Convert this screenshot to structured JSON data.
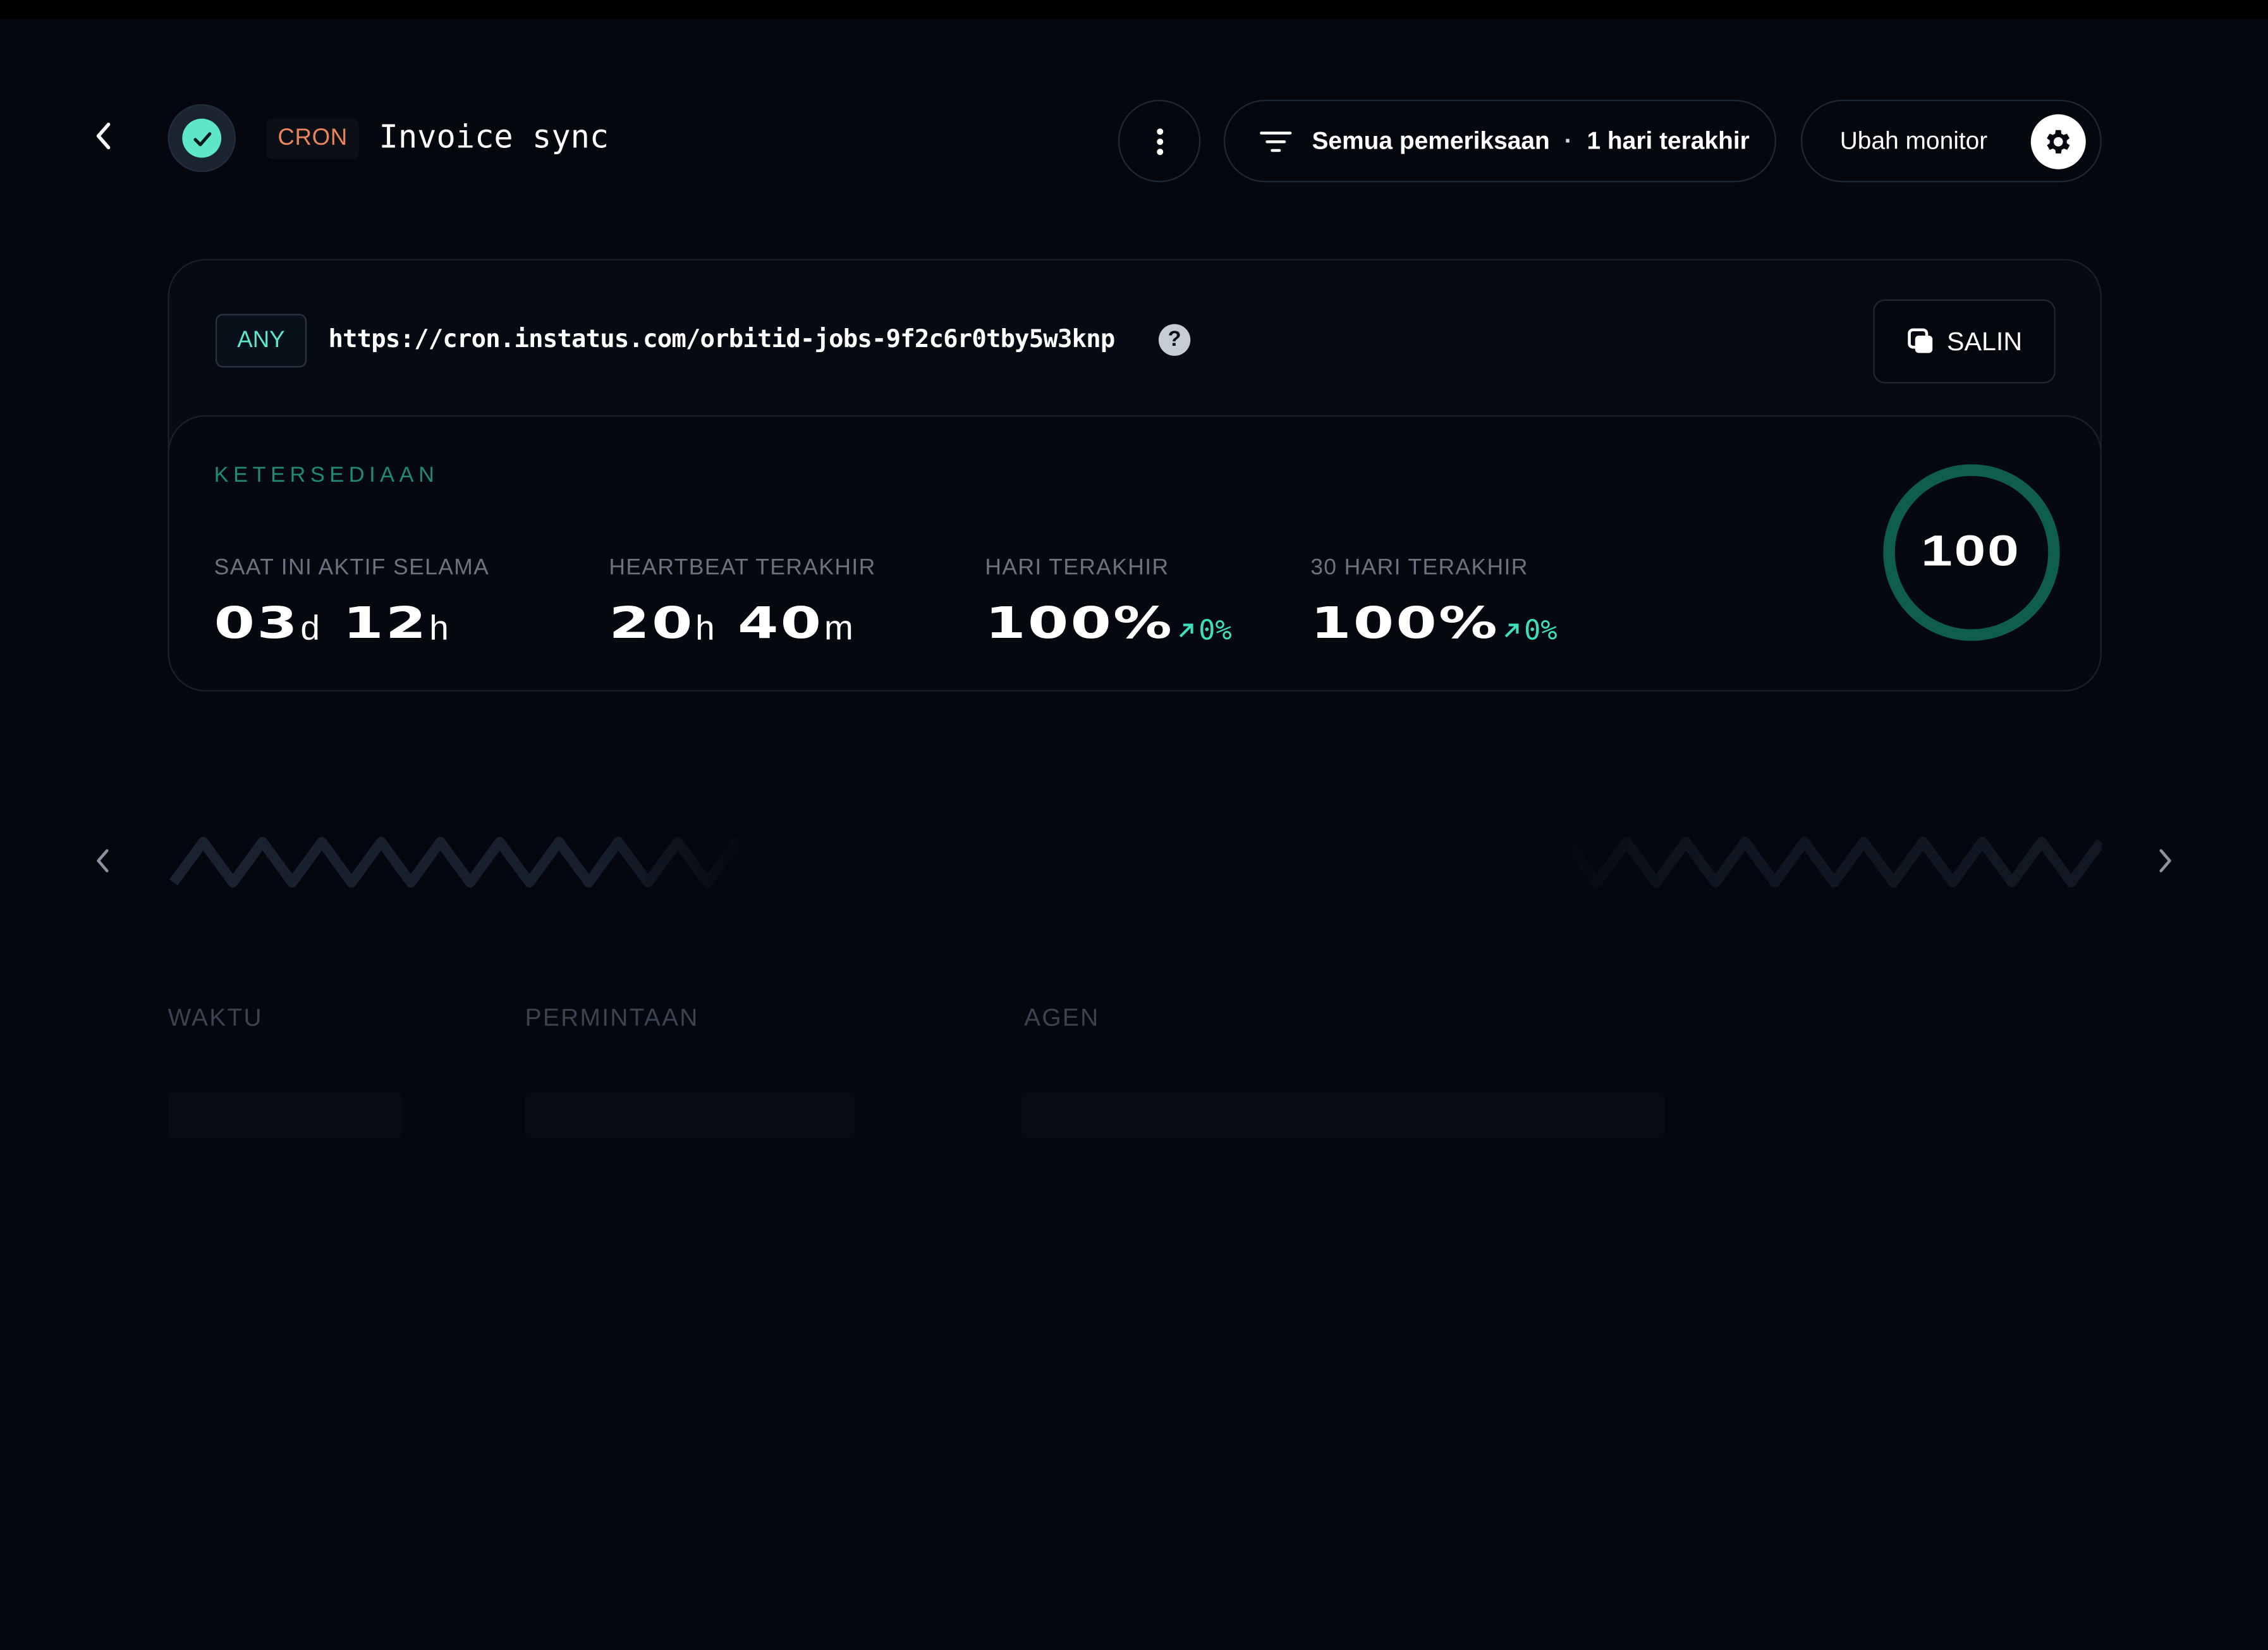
{
  "header": {
    "monitor_type": "CRON",
    "monitor_name": "Invoice sync",
    "status": "up",
    "filter": {
      "checks": "Semua pemeriksaan",
      "separator": "·",
      "range": "1 hari terakhir"
    },
    "edit_label": "Ubah monitor"
  },
  "endpoint": {
    "method": "ANY",
    "url": "https://cron.instatus.com/orbitid-jobs-9f2c6r0tby5w3knp",
    "help": "?",
    "copy_label": "SALIN"
  },
  "availability": {
    "title": "KETERSEDIAAN",
    "stats": [
      {
        "label": "SAAT INI AKTIF SELAMA",
        "parts": [
          {
            "n": "03",
            "u": "d"
          },
          {
            "n": "12",
            "u": "h"
          }
        ]
      },
      {
        "label": "HEARTBEAT TERAKHIR",
        "parts": [
          {
            "n": "20",
            "u": "h"
          },
          {
            "n": "40",
            "u": "m"
          }
        ]
      },
      {
        "label": "HARI TERAKHIR",
        "value": "100%",
        "delta": "0%"
      },
      {
        "label": "30 HARI TERAKHIR",
        "value": "100%",
        "delta": "0%"
      }
    ],
    "score": "100",
    "score_fraction": 1.0
  },
  "colors": {
    "accent": "#5ee6c9",
    "tag_orange": "#e8855d",
    "ring": "#0f5d4f",
    "background": "#04070e"
  },
  "table": {
    "columns": [
      "WAKTU",
      "PERMINTAAN",
      "AGEN"
    ]
  },
  "icons": {
    "back": "chevron-left-icon",
    "status": "check-icon",
    "more": "kebab-icon",
    "filter": "filter-lines-icon",
    "settings": "gear-icon",
    "copy": "copy-icon",
    "prev": "chevron-left-icon",
    "next": "chevron-right-icon"
  }
}
